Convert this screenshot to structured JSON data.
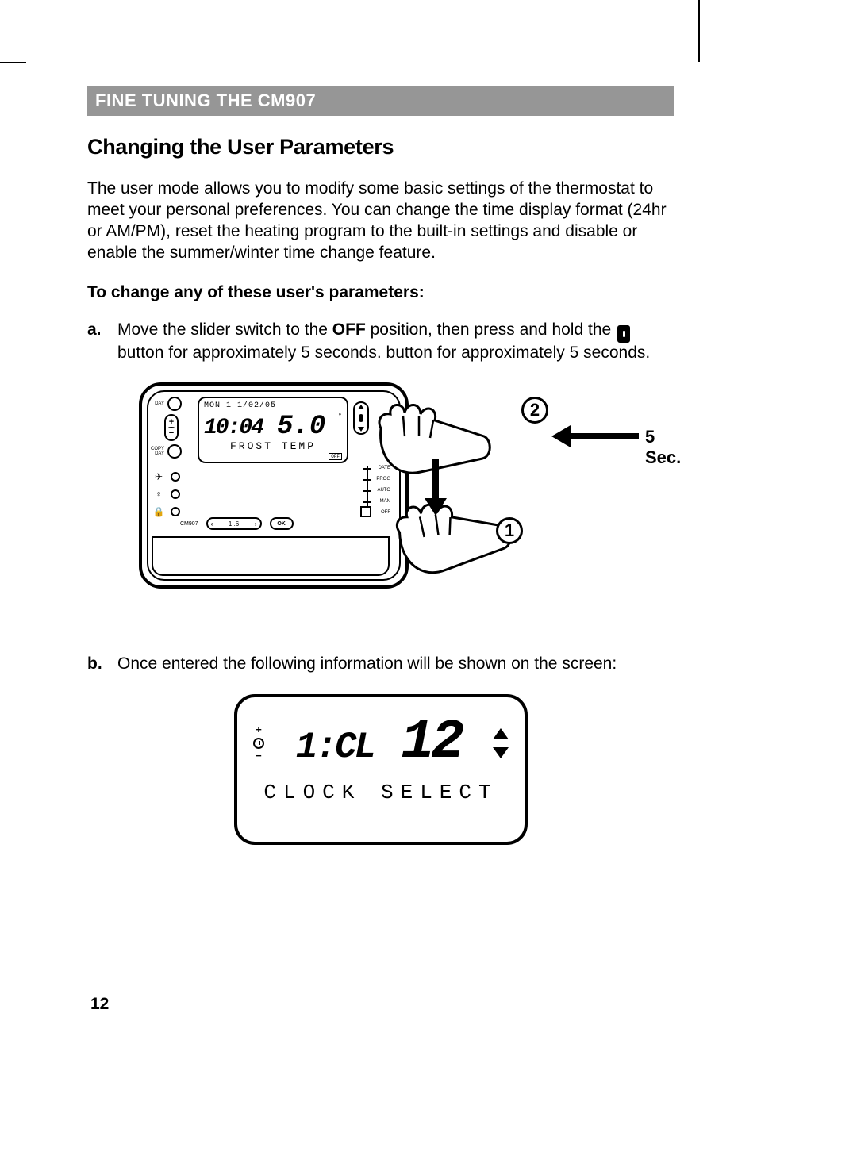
{
  "page_number": "12",
  "section_bar": "FINE TUNING THE CM907",
  "heading": "Changing the User Parameters",
  "intro": "The user mode allows you to modify some basic settings of the thermostat to meet your personal preferences. You can change the time display format (24hr or AM/PM), reset the heating program to the built-in settings and disable or enable the summer/winter time change feature.",
  "lead": "To change any of these user's parameters:",
  "steps": {
    "a": {
      "marker": "a.",
      "pre": "Move the slider switch to the ",
      "bold1": "OFF",
      "mid": " position, then press and hold the ",
      "post": " button for approximately 5 seconds. button for approximately 5 seconds."
    },
    "b": {
      "marker": "b.",
      "text": "Once entered the following information will be shown on the screen:"
    }
  },
  "fig1": {
    "callout_1": "1",
    "callout_2": "2",
    "hold_label": "5 Sec.",
    "lcd": {
      "date": "MON 1 1/02/05",
      "time": "10:04",
      "temp": "5.0",
      "subtitle": "FROST TEMP",
      "off": "OFF"
    },
    "left": {
      "day": "DAY",
      "copy": "COPY\nDAY"
    },
    "slider": {
      "l0": "DATE",
      "l1": "PROG",
      "l2": "AUTO",
      "l3": "MAN",
      "l4": "OFF"
    },
    "bottom": {
      "model": "CM907",
      "nav_mid": "1..6",
      "ok": "OK"
    }
  },
  "fig2": {
    "left_plus": "+",
    "left_minus": "−",
    "code": "1:CL",
    "value": "12",
    "label": "CLOCK SELECT"
  }
}
